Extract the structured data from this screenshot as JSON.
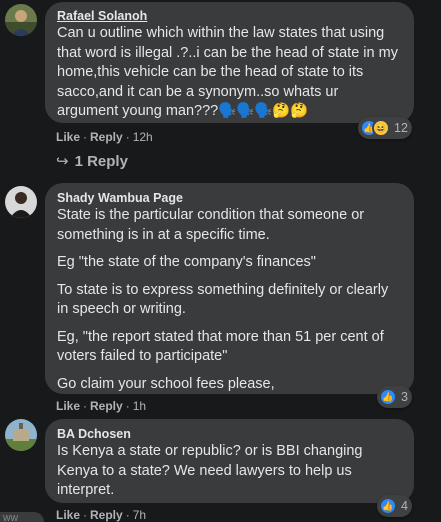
{
  "comments": [
    {
      "author": "Rafael Solanoh",
      "paragraphs": [
        "Can u outline which within the law states that using that word is illegal .?..i can be the head of state in my home,this vehicle can be the head of state to its sacco,and it can be a synonym..so whats ur argument young man???🗣️🗣️🗣️🤔🤔"
      ],
      "like_label": "Like",
      "reply_label": "Reply",
      "time": "12h",
      "reaction_count": "12",
      "reaction_icons": [
        "like-icon",
        "haha-icon"
      ]
    },
    {
      "author": "Shady Wambua Page",
      "paragraphs": [
        "State is the particular condition that someone or something is in at a specific time.",
        "Eg \"the state of the company's finances\"",
        "To state is to express something definitely or clearly in speech or writing.",
        "Eg, \"the report stated that more than 51 per cent of voters failed to participate\"",
        "Go claim your school fees please,"
      ],
      "like_label": "Like",
      "reply_label": "Reply",
      "time": "1h",
      "reaction_count": "3",
      "reaction_icons": [
        "like-icon"
      ]
    },
    {
      "author": "BA Dchosen",
      "paragraphs": [
        "Is Kenya a state or republic? or is BBI changing Kenya to a state? We need lawyers to help us interpret."
      ],
      "like_label": "Like",
      "reply_label": "Reply",
      "time": "7h",
      "reaction_count": "4",
      "reaction_icons": [
        "like-icon"
      ]
    }
  ],
  "replies_link": {
    "arrow": "↪",
    "label": "1 Reply"
  },
  "separator": "·",
  "edge_avatar_text": "WW"
}
